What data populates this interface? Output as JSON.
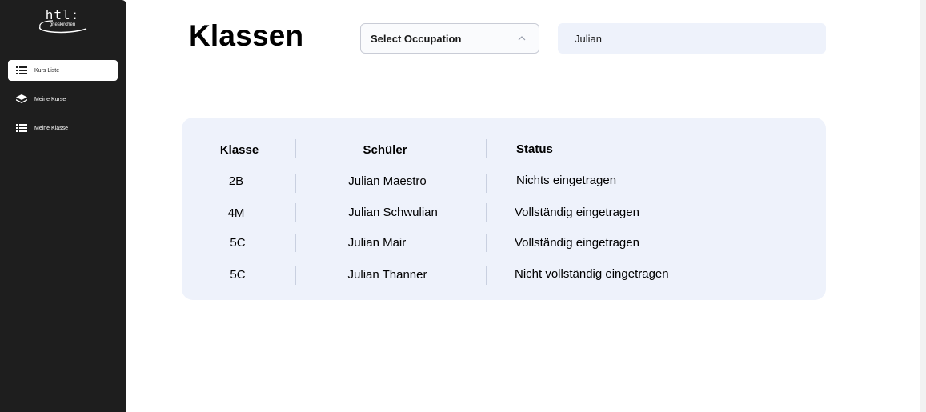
{
  "sidebar": {
    "logo": {
      "main": "htl:",
      "sub": "grieskirchen"
    },
    "items": [
      {
        "label": "Kurs Liste",
        "icon": "list-icon",
        "active": true
      },
      {
        "label": "Meine Kurse",
        "icon": "layers-icon",
        "active": false
      },
      {
        "label": "Meine Klasse",
        "icon": "list-icon",
        "active": false
      }
    ]
  },
  "header": {
    "title": "Klassen",
    "occupation_select": {
      "label": "Select Occupation",
      "icon": "chevron-up-icon"
    },
    "search": {
      "value": "Julian "
    }
  },
  "table": {
    "columns": [
      "Klasse",
      "Schüler",
      "Status"
    ],
    "rows": [
      {
        "klasse": "2B",
        "schueler": "Julian Maestro",
        "status": "Nichts eingetragen"
      },
      {
        "klasse": "4M",
        "schueler": "Julian Schwulian",
        "status": "Vollständig eingetragen"
      },
      {
        "klasse": "5C",
        "schueler": "Julian Mair",
        "status": "Vollständig eingetragen"
      },
      {
        "klasse": "5C",
        "schueler": "Julian Thanner",
        "status": "Nicht vollständig eingetragen"
      }
    ]
  },
  "colors": {
    "sidebar": "#1e1e1e",
    "card": "#eef2fb",
    "search": "#eef2fb"
  }
}
